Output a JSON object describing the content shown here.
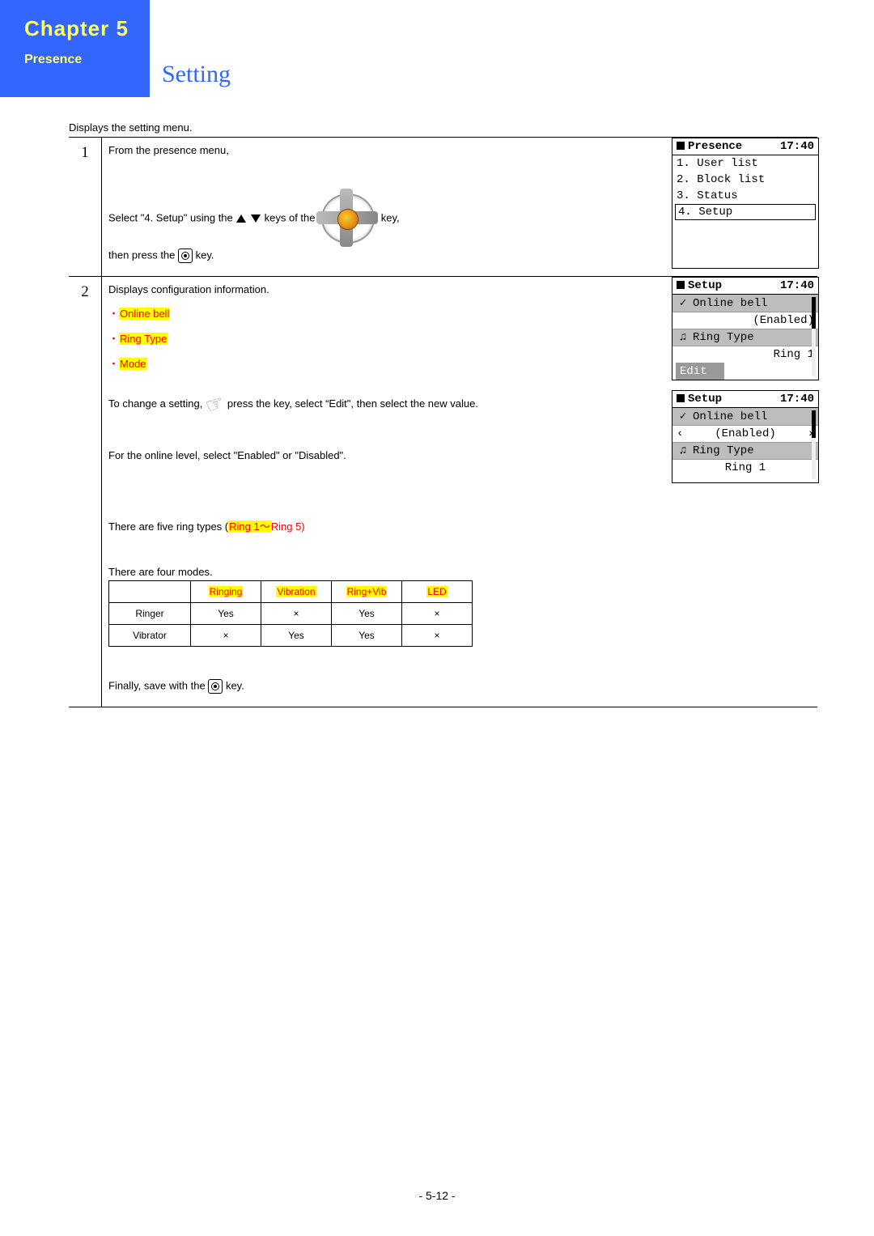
{
  "header": {
    "chapter": "Chapter 5",
    "section": "Presence",
    "title": "Setting"
  },
  "caption": "Displays the setting menu.",
  "step1": {
    "num": "1",
    "line1": "From the presence menu,",
    "select_pre": "Select \"4. Setup\" using the ",
    "select_mid": " keys of the ",
    "select_post": " key,",
    "then_pre": "then press the ",
    "then_post": " key.",
    "screen": {
      "title": "Presence",
      "time": "17:40",
      "items": [
        "1. User list",
        "2. Block list",
        "3. Status"
      ],
      "selected": "4. Setup"
    }
  },
  "step2": {
    "num": "2",
    "heading": "Displays configuration information.",
    "bullets": [
      "Online bell",
      "Ring Type",
      "Mode"
    ],
    "change_pre": "To change a setting,",
    "change_post": "press the  key, select “Edit\", then select the new value.",
    "online_note": "For the online level, select \"Enabled\" or \"Disabled\".",
    "ring_pre": "There are five ring types (",
    "ring_hl": "Ring 1～",
    "ring_post": "Ring 5)",
    "modes_intro": "There are four modes.",
    "modes_headers": [
      "Ringing",
      "Vibration",
      "Ring+Vib",
      "LED"
    ],
    "modes_rows": [
      {
        "label": "Ringer",
        "cells": [
          "Yes",
          "×",
          "Yes",
          "×"
        ]
      },
      {
        "label": "Vibrator",
        "cells": [
          "×",
          "Yes",
          "Yes",
          "×"
        ]
      }
    ],
    "finally_pre": "Finally, save with the ",
    "finally_post": " key.",
    "screenA": {
      "title": "Setup",
      "time": "17:40",
      "row1_icon": "✓",
      "row1": "Online bell",
      "row2": "(Enabled)",
      "row3_icon": "♫",
      "row3": "Ring Type",
      "row4": "Ring 1",
      "edit": "Edit"
    },
    "screenB": {
      "title": "Setup",
      "time": "17:40",
      "row1_icon": "✓",
      "row1": "Online bell",
      "row2_left": "‹",
      "row2": "(Enabled)",
      "row2_right": "›",
      "row3_icon": "♫",
      "row3": "Ring Type",
      "row4": "Ring 1"
    }
  },
  "footer": "- 5-12 -"
}
